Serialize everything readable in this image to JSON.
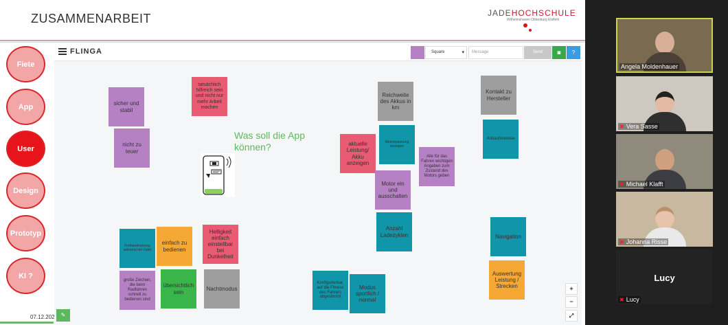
{
  "slide": {
    "title": "ZUSAMMENARBEIT",
    "logo": {
      "part1": "JADE",
      "part2": "HOCHSCHULE",
      "sub": "Wilhelmshaven Oldenburg Elsfleth"
    },
    "nav": [
      "Fiete",
      "App",
      "User",
      "Design",
      "Prototyp",
      "KI ?"
    ],
    "active_nav": "User",
    "date": "07.12.202"
  },
  "board": {
    "brand": "FLINGA",
    "shape": "Square",
    "message_placeholder": "Message",
    "send_label": "Send",
    "question": "Was soll die App können?",
    "notes": [
      {
        "text": "sicher und stabil",
        "color": "purple"
      },
      {
        "text": "nicht zu teuer",
        "color": "purple"
      },
      {
        "text": "tatsächlich hilfreich sein und nicht nur mehr Arbeit machen",
        "color": "red"
      },
      {
        "text": "Reichweite des Akkus in km",
        "color": "gray"
      },
      {
        "text": "Kontakt zu Hersteller",
        "color": "gray"
      },
      {
        "text": "Motorspannung anzeigen",
        "color": "teal"
      },
      {
        "text": "Anbauhinweise",
        "color": "teal"
      },
      {
        "text": "aktuelle Leistung/ Akku anzeigen",
        "color": "red"
      },
      {
        "text": "Alle für das Fahren wichtigen Angaben zum Zustand des Motors geben",
        "color": "purple"
      },
      {
        "text": "Motor ein und ausschalten",
        "color": "purple"
      },
      {
        "text": "Anzahl Ladezyklen",
        "color": "teal"
      },
      {
        "text": "Navigation",
        "color": "teal"
      },
      {
        "text": "Freihandnutzung während der Fahrt",
        "color": "teal"
      },
      {
        "text": "einfach zu bedienen",
        "color": "orange"
      },
      {
        "text": "Helligkeit einfach einstellbar bei Dunkelheit",
        "color": "red"
      },
      {
        "text": "große Zeichen, die beim Radfahren schnell zu bedienen sind",
        "color": "purple"
      },
      {
        "text": "übersichtlich sein",
        "color": "green"
      },
      {
        "text": "Nachtmodus",
        "color": "gray"
      },
      {
        "text": "Konfigurierbar, auf die Fitness des Fahrers abgestimmt",
        "color": "teal"
      },
      {
        "text": "Modus sportlich / normal",
        "color": "teal"
      },
      {
        "text": "Auswertung Leistung / Strecken",
        "color": "orange"
      }
    ]
  },
  "participants": [
    {
      "name": "Angela Moldenhauer",
      "muted": false
    },
    {
      "name": "Vera Sasse",
      "muted": true
    },
    {
      "name": "Michael Klafft",
      "muted": true
    },
    {
      "name": "Johanna Risse",
      "muted": true
    },
    {
      "name": "Lucy",
      "muted": true,
      "avatar_text": "Lucy"
    }
  ],
  "colors": {
    "purple": "#b680c4",
    "red": "#e85b73",
    "gray": "#9e9e9e",
    "teal": "#1096a8",
    "orange": "#f5a834",
    "green": "#39b54a",
    "active_speaker": "#c9d64a"
  }
}
